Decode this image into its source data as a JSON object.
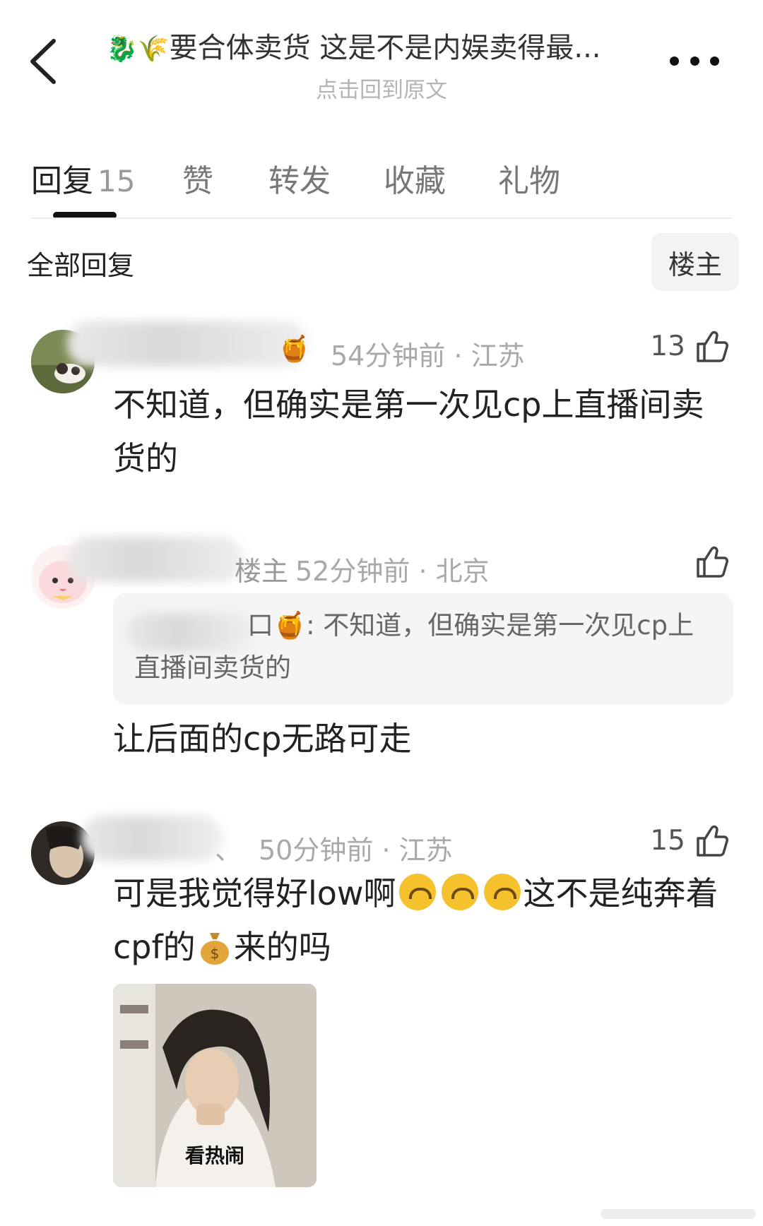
{
  "header": {
    "title_emojis": "🐉🌾",
    "title": "要合体卖货 这是不是内娱卖得最...",
    "subtitle": "点击回到原文"
  },
  "tabs": [
    {
      "label": "回复",
      "count": "15",
      "active": true
    },
    {
      "label": "赞"
    },
    {
      "label": "转发"
    },
    {
      "label": "收藏"
    },
    {
      "label": "礼物"
    }
  ],
  "filter": {
    "title": "全部回复",
    "op_button": "楼主"
  },
  "comments": [
    {
      "name_tail": "🍯",
      "time": "54分钟前",
      "location": "江苏",
      "likes": "13",
      "text": "不知道，但确实是第一次见cp上直播间卖货的"
    },
    {
      "name_tail": "楼主",
      "time": "52分钟前",
      "location": "北京",
      "likes": "",
      "quote_name_tail": "口🍯",
      "quote_text": ": 不知道，但确实是第一次见cp上直播间卖货的",
      "text": "让后面的cp无路可走"
    },
    {
      "name_tail": "、",
      "time": "50分钟前",
      "location": "江苏",
      "likes": "15",
      "text_part1": "可是我觉得好low啊",
      "text_part2": "这不是纯奔着cpf的",
      "text_part3": "来的吗",
      "sticker_caption": "看热闹"
    }
  ],
  "icons": [
    "back-arrow-icon",
    "more-dots-icon",
    "thumbs-up-icon",
    "upside-down-face-emoji",
    "money-bag-emoji"
  ]
}
